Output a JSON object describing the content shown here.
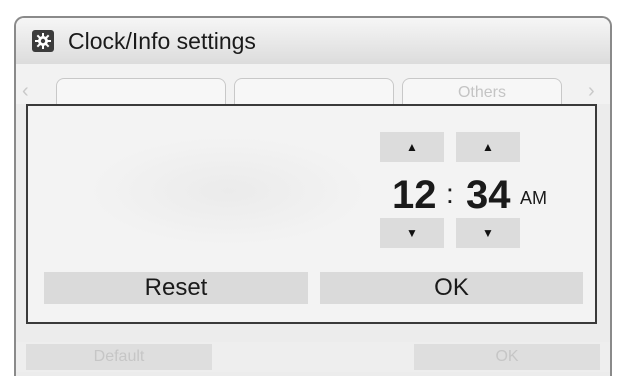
{
  "window": {
    "title": "Clock/Info settings",
    "icon": "gear-icon"
  },
  "tabs": [
    {
      "label": ""
    },
    {
      "label": ""
    },
    {
      "label": "Others"
    }
  ],
  "dialog": {
    "hour": "12",
    "separator": ":",
    "minute": "34",
    "ampm": "AM",
    "up_arrow": "▲",
    "down_arrow": "▼",
    "reset_label": "Reset",
    "ok_label": "OK"
  },
  "footer": {
    "default_label": "Default",
    "ok_label": "OK"
  }
}
